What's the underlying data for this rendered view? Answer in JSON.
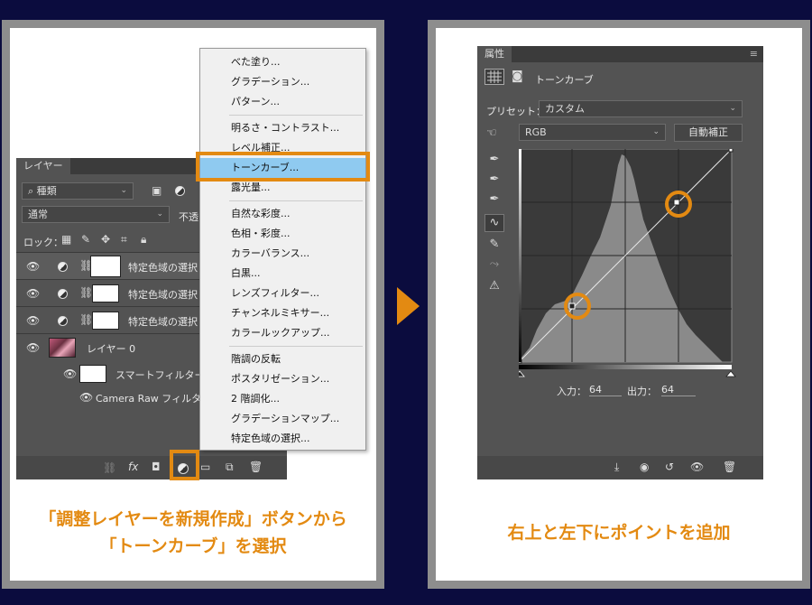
{
  "left_caption": [
    "「調整レイヤーを新規作成」ボタンから",
    "「トーンカーブ」を選択"
  ],
  "right_caption": "右上と左下にポイントを追加",
  "layers_panel": {
    "tab": "レイヤー",
    "kind_filter": "種類",
    "blend_mode": "通常",
    "opacity_label": "不透",
    "lock_label": "ロック：",
    "layers": [
      {
        "name": "特定色域の選択"
      },
      {
        "name": "特定色域の選択"
      },
      {
        "name": "特定色域の選択"
      },
      {
        "name": "レイヤー 0"
      },
      {
        "name": "スマートフィルター"
      },
      {
        "name": "Camera Raw フィルター"
      }
    ],
    "fx_label": "fx"
  },
  "menu": {
    "items": [
      "べた塗り...",
      "グラデーション...",
      "パターン...",
      "明るさ・コントラスト...",
      "レベル補正...",
      "トーンカーブ...",
      "露光量...",
      "自然な彩度...",
      "色相・彩度...",
      "カラーバランス...",
      "白黒...",
      "レンズフィルター...",
      "チャンネルミキサー...",
      "カラールックアップ...",
      "階調の反転",
      "ポスタリゼーション...",
      "2 階調化...",
      "グラデーションマップ...",
      "特定色域の選択..."
    ],
    "highlighted": "トーンカーブ..."
  },
  "properties_panel": {
    "tab": "属性",
    "title": "トーンカーブ",
    "preset_label": "プリセット：",
    "preset_value": "カスタム",
    "channel": "RGB",
    "auto_button": "自動補正",
    "input_label": "入力：",
    "input_value": "64",
    "output_label": "出力：",
    "output_value": "64"
  },
  "colors": {
    "accent": "#e38a12",
    "background": "#0b0c3e",
    "panel": "#535353",
    "highlight": "#8fcaf0"
  }
}
